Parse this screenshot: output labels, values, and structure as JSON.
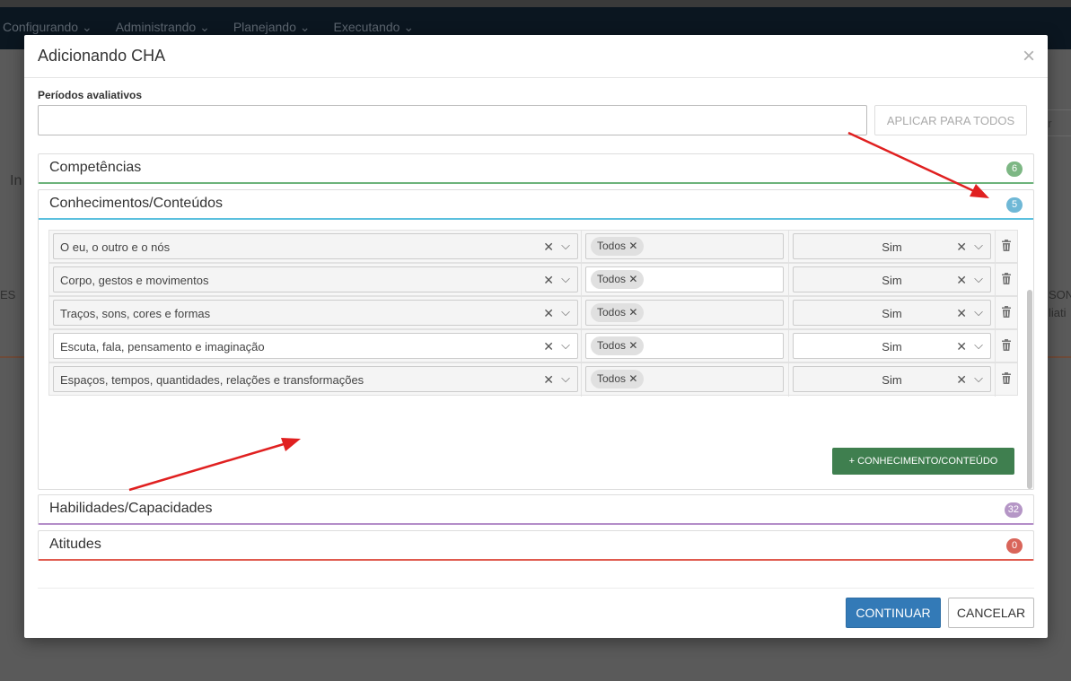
{
  "background": {
    "nav": [
      "Configurando",
      "Administrando",
      "Planejando",
      "Executando"
    ],
    "fragments": [
      "In",
      "ES",
      "SON",
      "liati",
      "ar"
    ]
  },
  "modal": {
    "title": "Adicionando CHA",
    "periodos_label": "Períodos avaliativos",
    "periodos_value": "",
    "aplicar_label": "APLICAR PARA TODOS",
    "panels": {
      "competencias": {
        "title": "Competências",
        "count": "6"
      },
      "conhecimentos": {
        "title": "Conhecimentos/Conteúdos",
        "count": "5"
      },
      "habilidades": {
        "title": "Habilidades/Capacidades",
        "count": "32"
      },
      "atitudes": {
        "title": "Atitudes",
        "count": "0"
      }
    },
    "rows": [
      {
        "item": "O eu, o outro e o nós",
        "tag": "Todos",
        "value": "Sim"
      },
      {
        "item": "Corpo, gestos e movimentos",
        "tag": "Todos",
        "value": "Sim"
      },
      {
        "item": "Traços, sons, cores e formas",
        "tag": "Todos",
        "value": "Sim"
      },
      {
        "item": "Escuta, fala, pensamento e imaginação",
        "tag": "Todos",
        "value": "Sim"
      },
      {
        "item": "Espaços, tempos, quantidades, relações e transformações",
        "tag": "Todos",
        "value": "Sim"
      }
    ],
    "add_button": "+ CONHECIMENTO/CONTEÚDO",
    "continue_button": "CONTINUAR",
    "cancel_button": "CANCELAR"
  },
  "colors": {
    "primary": "#337ab7",
    "success": "#3f7f4f",
    "competencias": "#6cb37a",
    "conhecimentos": "#5bc0de",
    "habilidades": "#b38cc8",
    "atitudes": "#e05a4e",
    "annotation_arrow": "#e02020"
  }
}
